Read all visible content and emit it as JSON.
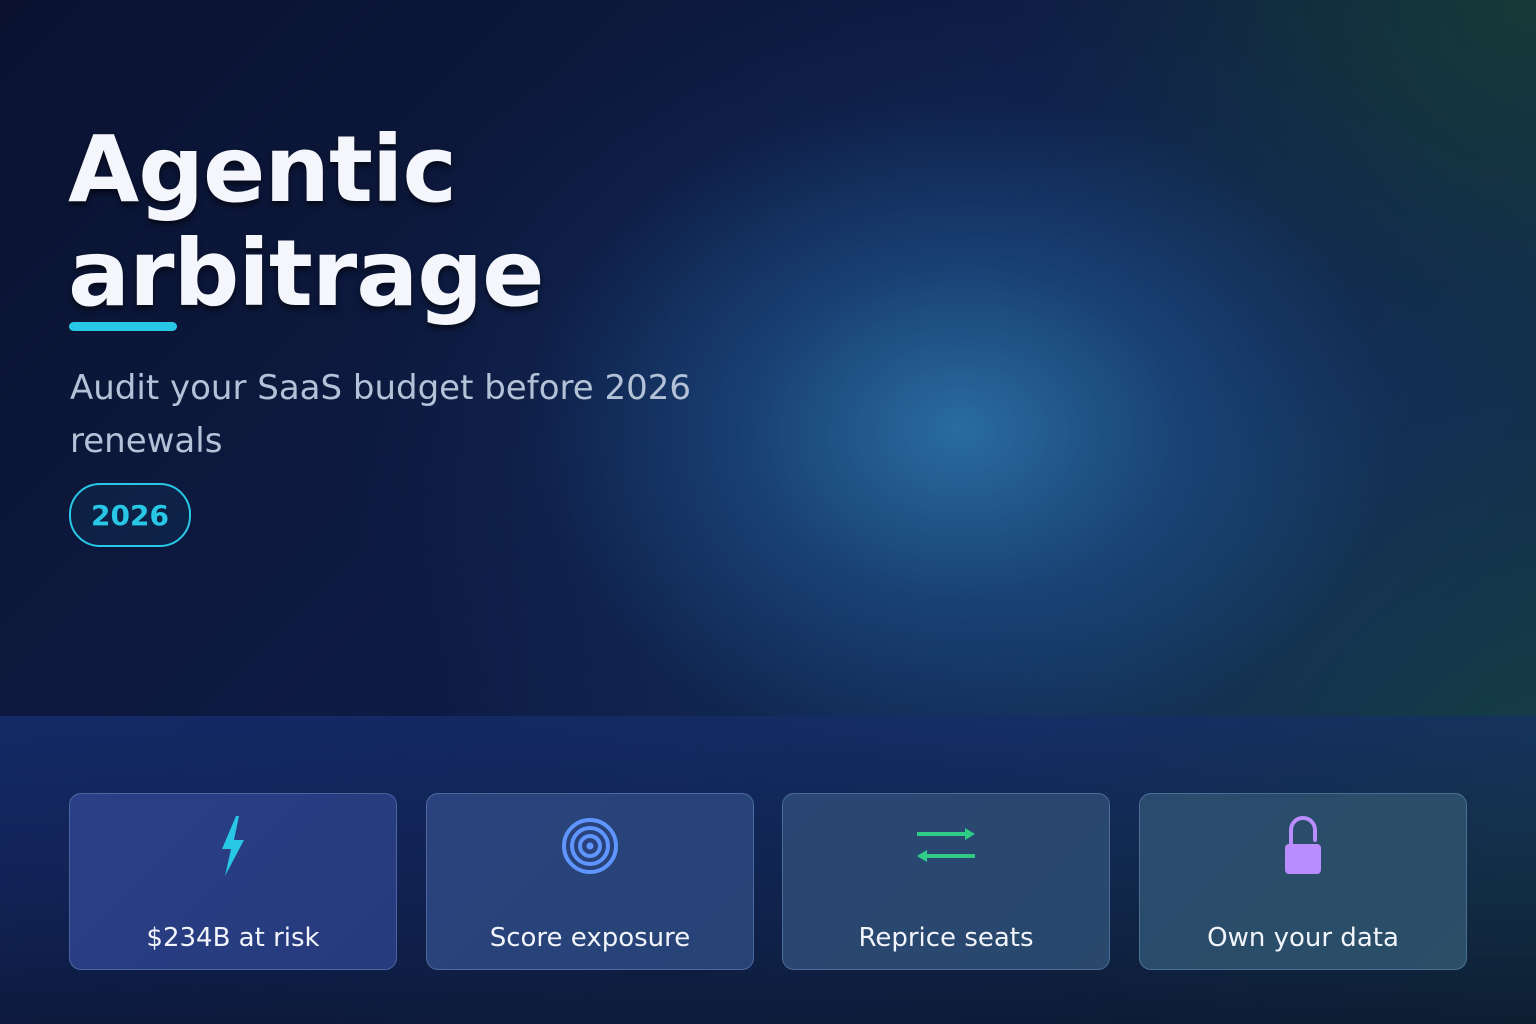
{
  "hero": {
    "title_line1": "Agentic",
    "title_line2": "arbitrage",
    "subtitle": "Audit your SaaS budget before 2026 renewals",
    "year_badge": "2026"
  },
  "cards": [
    {
      "label": "$234B at risk",
      "icon": "lightning-icon",
      "icon_color": "#29c7e6"
    },
    {
      "label": "Score exposure",
      "icon": "target-icon",
      "icon_color": "#5f95ff"
    },
    {
      "label": "Reprice seats",
      "icon": "swap-arrows-icon",
      "icon_color": "#2ecc87"
    },
    {
      "label": "Own your data",
      "icon": "unlock-icon",
      "icon_color": "#b98cff"
    }
  ],
  "colors": {
    "accent": "#29c7e6",
    "background": "#0e1c45",
    "text": "#f4f6fb",
    "subtitle": "#b4c2d8"
  }
}
